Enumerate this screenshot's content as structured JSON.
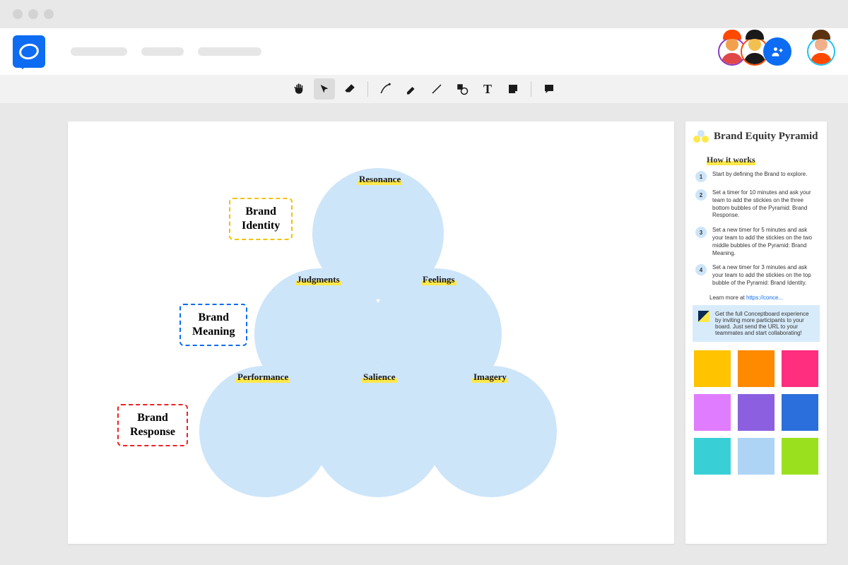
{
  "pyramid": {
    "top": {
      "label": "Resonance"
    },
    "midL": {
      "label": "Judgments"
    },
    "midR": {
      "label": "Feelings"
    },
    "botL": {
      "label": "Performance"
    },
    "botM": {
      "label": "Salience"
    },
    "botR": {
      "label": "Imagery"
    }
  },
  "sideLabels": {
    "identity": "Brand\nIdentity",
    "meaning": "Brand\nMeaning",
    "response": "Brand\nResponse"
  },
  "panel": {
    "title": "Brand Equity Pyramid",
    "howTitle": "How it works",
    "steps": [
      "Start by defining the Brand to explore.",
      "Set a timer for 10 minutes and ask your team to add the stickies on the three bottom bubbles of the Pyramid: Brand Response.",
      "Set a new timer for 5 minutes and ask your team to add the stickies on the two middle bubbles of the Pyramid: Brand Meaning.",
      "Set a new timer for 3 minutes and ask your team to add the stickies on the top bubble of the Pyramid: Brand Identity."
    ],
    "learnPrefix": "Learn more at ",
    "learnLink": "https://conce...",
    "tip": "Get the full Conceptboard experience by inviting more participants to your board. Just send the URL to your teammates and start collaborating!"
  },
  "stickies": [
    {
      "c": "#ffc300",
      "s": "#d79b00"
    },
    {
      "c": "#ff8a00",
      "s": "#cc6a00"
    },
    {
      "c": "#ff2e7e",
      "s": "#cc1e60"
    },
    {
      "c": "#e07cff",
      "s": "#b45fd6"
    },
    {
      "c": "#8b5fe0",
      "s": "#6a45b3"
    },
    {
      "c": "#2a6fdc",
      "s": "#1e54ad"
    },
    {
      "c": "#38d0d6",
      "s": "#2aa6ab"
    },
    {
      "c": "#aed4f5",
      "s": "#86b4e0"
    },
    {
      "c": "#9be01e",
      "s": "#7ab418"
    }
  ]
}
